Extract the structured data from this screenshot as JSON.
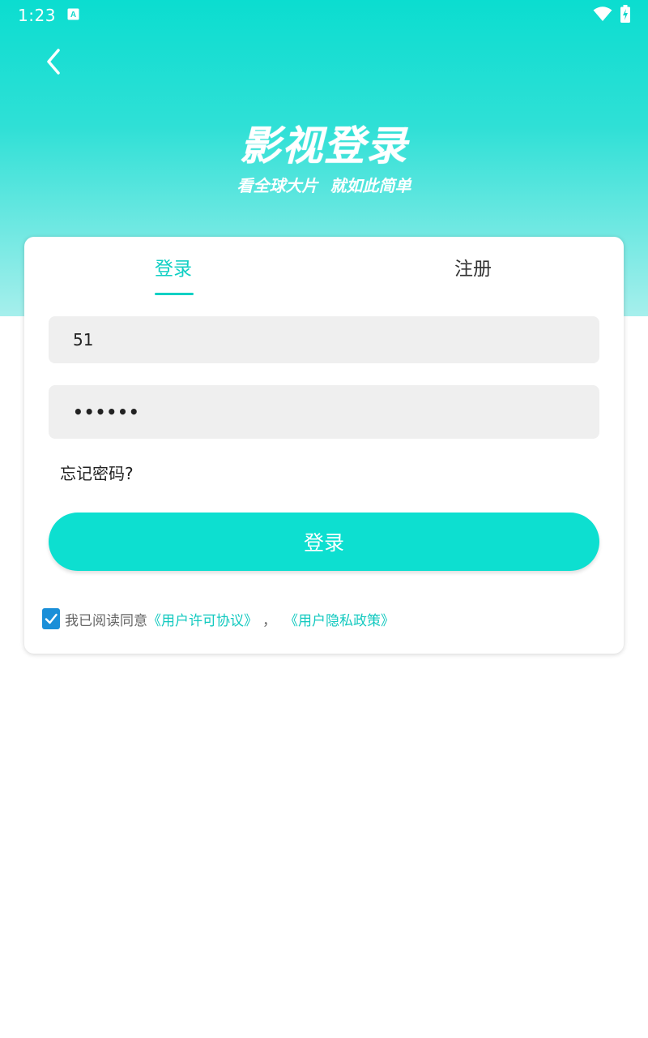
{
  "status_bar": {
    "time": "1:23",
    "icons": [
      "app-a-icon",
      "wifi-icon",
      "battery-charging-icon"
    ]
  },
  "header": {
    "back_icon": "chevron-left-icon",
    "title": "影视登录",
    "subtitle": "看全球大片 就如此简单"
  },
  "tabs": {
    "login": "登录",
    "register": "注册",
    "active": "login"
  },
  "form": {
    "account_value": "51",
    "password_value": "••••••",
    "forgot_password": "忘记密码?",
    "login_button": "登录"
  },
  "agreement": {
    "checked": true,
    "prefix": "我已阅读同意",
    "user_license": "《用户许可协议》",
    "separator": "，",
    "privacy_policy": "《用户隐私政策》"
  },
  "colors": {
    "accent": "#0ddfd0",
    "link": "#12c9bf",
    "checkbox": "#1a8fd8"
  }
}
